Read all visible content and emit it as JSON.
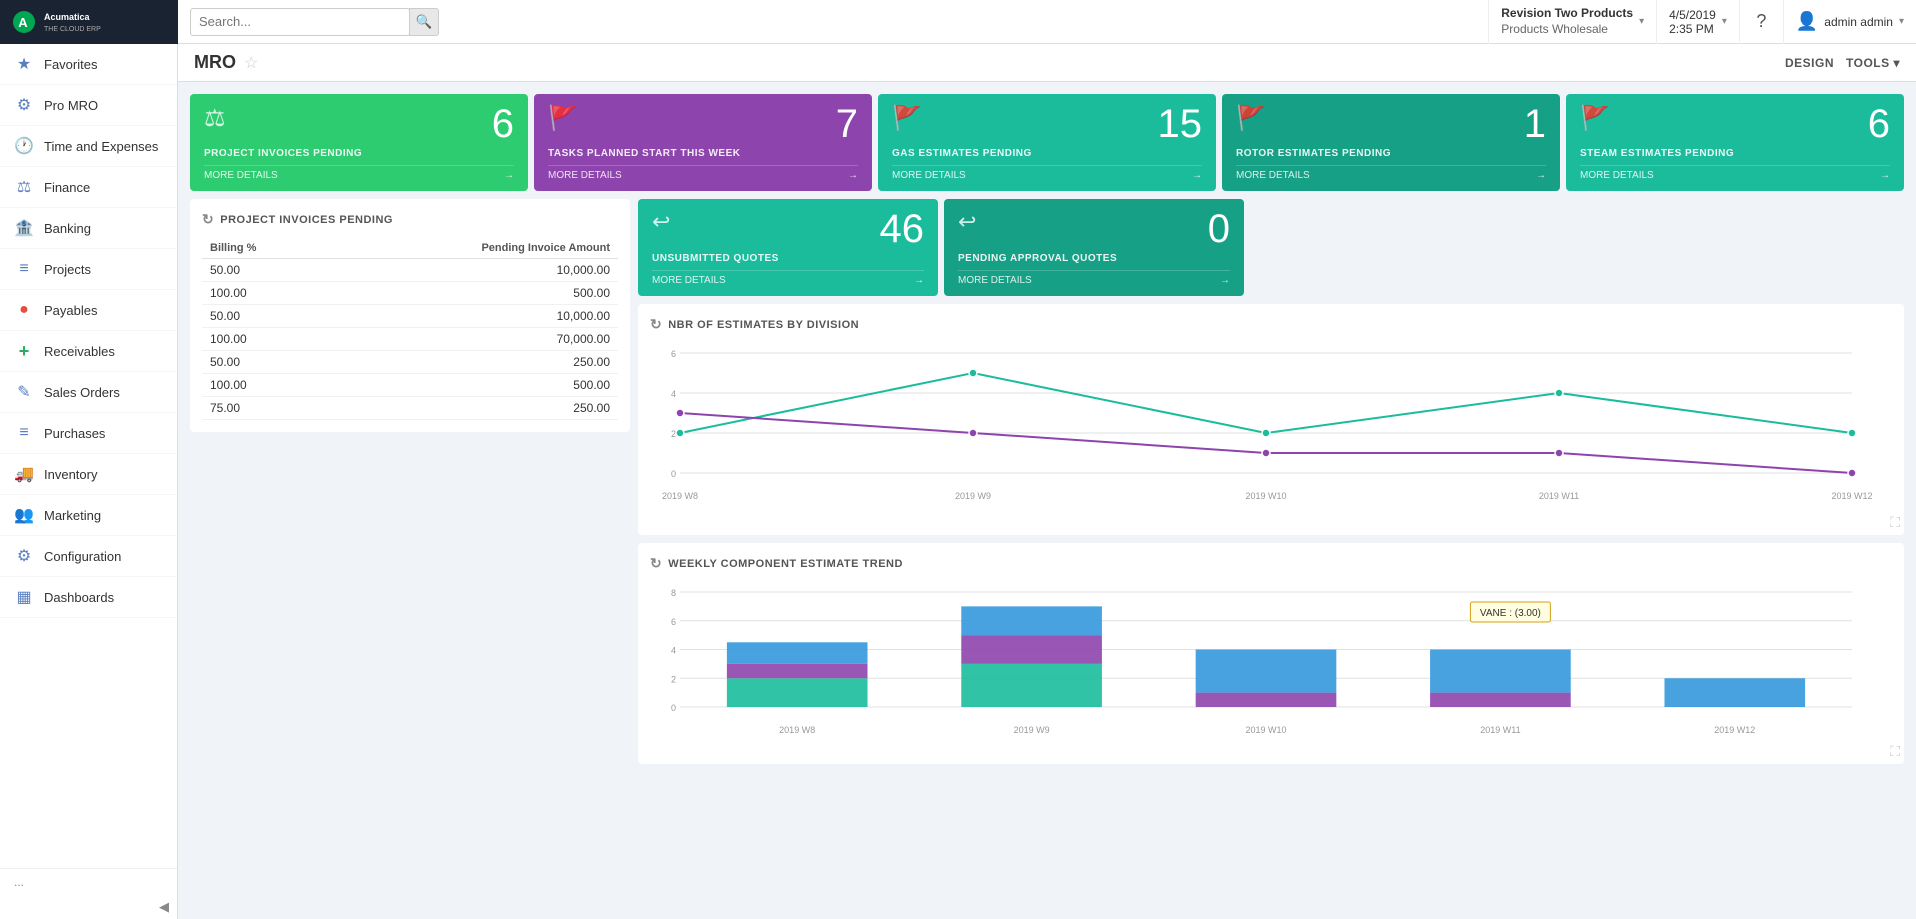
{
  "topbar": {
    "logo_alt": "Acumatica The Cloud ERP",
    "search_placeholder": "Search...",
    "company_name": "Revision Two Products",
    "company_sub": "Products Wholesale",
    "date": "4/5/2019",
    "time": "2:35 PM",
    "help_label": "?",
    "user_label": "admin admin"
  },
  "sidebar": {
    "items": [
      {
        "id": "favorites",
        "label": "Favorites",
        "icon": "★"
      },
      {
        "id": "pro-mro",
        "label": "Pro MRO",
        "icon": "⚙"
      },
      {
        "id": "time-expenses",
        "label": "Time and Expenses",
        "icon": "🕐"
      },
      {
        "id": "finance",
        "label": "Finance",
        "icon": "⚖"
      },
      {
        "id": "banking",
        "label": "Banking",
        "icon": "🏦"
      },
      {
        "id": "projects",
        "label": "Projects",
        "icon": "≡"
      },
      {
        "id": "payables",
        "label": "Payables",
        "icon": "●"
      },
      {
        "id": "receivables",
        "label": "Receivables",
        "icon": "+"
      },
      {
        "id": "sales-orders",
        "label": "Sales Orders",
        "icon": "✎"
      },
      {
        "id": "purchases",
        "label": "Purchases",
        "icon": "≡"
      },
      {
        "id": "inventory",
        "label": "Inventory",
        "icon": "🚚"
      },
      {
        "id": "marketing",
        "label": "Marketing",
        "icon": "👥"
      },
      {
        "id": "configuration",
        "label": "Configuration",
        "icon": "⚙"
      },
      {
        "id": "dashboards",
        "label": "Dashboards",
        "icon": "▦"
      }
    ],
    "more_label": "...",
    "collapse_icon": "◀"
  },
  "page": {
    "title": "MRO",
    "design_btn": "DESIGN",
    "tools_btn": "TOOLS ▾"
  },
  "kpi_row1": [
    {
      "number": "6",
      "label": "PROJECT INVOICES PENDING",
      "footer": "MORE DETAILS",
      "color": "green",
      "icon": "⚖"
    },
    {
      "number": "7",
      "label": "TASKS PLANNED START THIS WEEK",
      "footer": "MORE DETAILS",
      "color": "purple",
      "icon": "🚩"
    },
    {
      "number": "15",
      "label": "GAS ESTIMATES PENDING",
      "footer": "MORE DETAILS",
      "color": "teal",
      "icon": "🚩"
    },
    {
      "number": "1",
      "label": "ROTOR ESTIMATES PENDING",
      "footer": "MORE DETAILS",
      "color": "teal",
      "icon": "🚩"
    },
    {
      "number": "6",
      "label": "STEAM ESTIMATES PENDING",
      "footer": "MORE DETAILS",
      "color": "teal",
      "icon": "🚩"
    }
  ],
  "kpi_row2": [
    {
      "number": "46",
      "label": "UNSUBMITTED QUOTES",
      "footer": "MORE DETAILS",
      "color": "teal",
      "icon": "↩"
    },
    {
      "number": "0",
      "label": "PENDING APPROVAL QUOTES",
      "footer": "MORE DETAILS",
      "color": "teal",
      "icon": "↩"
    }
  ],
  "invoices_table": {
    "title": "PROJECT INVOICES PENDING",
    "columns": [
      "Billing %",
      "Pending Invoice Amount"
    ],
    "rows": [
      [
        "50.00",
        "10,000.00"
      ],
      [
        "100.00",
        "500.00"
      ],
      [
        "50.00",
        "10,000.00"
      ],
      [
        "100.00",
        "70,000.00"
      ],
      [
        "50.00",
        "250.00"
      ],
      [
        "100.00",
        "500.00"
      ],
      [
        "75.00",
        "250.00"
      ]
    ]
  },
  "line_chart": {
    "title": "NBR OF ESTIMATES BY DIVISION",
    "x_labels": [
      "2019 W8",
      "2019 W9",
      "2019 W10",
      "2019 W11",
      "2019 W12"
    ],
    "y_max": 6,
    "series": [
      {
        "name": "series1",
        "color": "#1abc9c",
        "points": [
          2,
          5,
          2,
          4,
          2
        ]
      },
      {
        "name": "series2",
        "color": "#8e44ad",
        "points": [
          3,
          2,
          1,
          1,
          0
        ]
      }
    ]
  },
  "bar_chart": {
    "title": "WEEKLY COMPONENT ESTIMATE TREND",
    "x_labels": [
      "2019 W8",
      "2019 W9",
      "2019 W10",
      "2019 W11",
      "2019 W12"
    ],
    "y_max": 8,
    "tooltip": "VANE : (3.00)",
    "tooltip_x_index": 3,
    "series": [
      {
        "name": "series1",
        "color": "#1abc9c",
        "values": [
          2,
          3,
          0,
          0,
          0
        ]
      },
      {
        "name": "series2",
        "color": "#8e44ad",
        "values": [
          1,
          2,
          1,
          1,
          0
        ]
      },
      {
        "name": "series3",
        "color": "#3498db",
        "values": [
          1.5,
          2,
          3,
          3,
          2
        ]
      }
    ]
  }
}
